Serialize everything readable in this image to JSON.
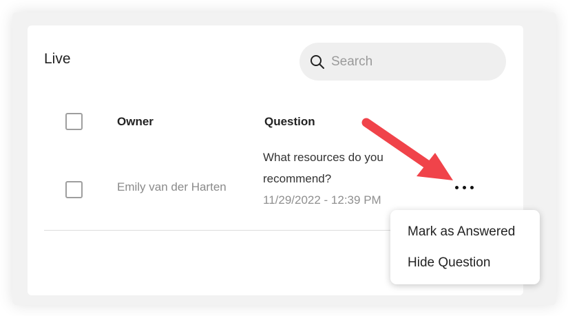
{
  "panel": {
    "title": "Live"
  },
  "search": {
    "placeholder": "Search",
    "icon": "search-icon"
  },
  "table": {
    "columns": [
      "Owner",
      "Question"
    ],
    "rows": [
      {
        "owner": "Emily van der Harten",
        "question": "What resources do you recommend?",
        "timestamp": "11/29/2022 - 12:39 PM",
        "actions_icon": "more-horizontal-icon"
      }
    ]
  },
  "context_menu": {
    "items": [
      "Mark as Answered",
      "Hide Question"
    ]
  },
  "annotation": {
    "arrow_color": "#f0434a"
  }
}
